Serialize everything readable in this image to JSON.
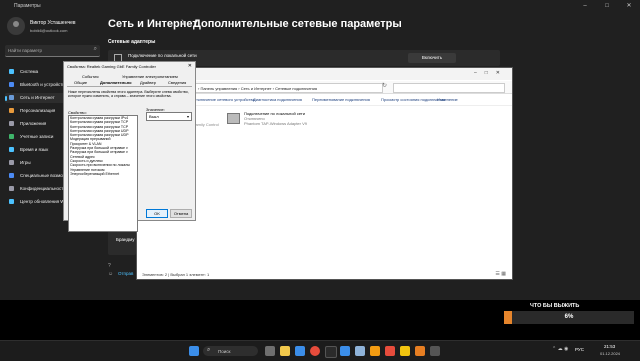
{
  "settings": {
    "title": "Параметры",
    "user": {
      "name": "Виктор Усташенчев",
      "email": "bobik6@outlook.com"
    },
    "search_placeholder": "Найти параметр",
    "nav": [
      {
        "label": "Система",
        "color": "#4cc2ff"
      },
      {
        "label": "Bluetooth и устройства",
        "color": "#4c8bf5"
      },
      {
        "label": "Сеть и Интернет",
        "color": "#6a9bd8"
      },
      {
        "label": "Персонализация",
        "color": "#e89a3c"
      },
      {
        "label": "Приложения",
        "color": "#9a9aa8"
      },
      {
        "label": "Учетные записи",
        "color": "#3fb56b"
      },
      {
        "label": "Время и язык",
        "color": "#4cc2ff"
      },
      {
        "label": "Игры",
        "color": "#9a9aa8"
      },
      {
        "label": "Специальные возможности",
        "color": "#4c8bf5"
      },
      {
        "label": "Конфиденциальность и защита",
        "color": "#9a9aa8"
      },
      {
        "label": "Центр обновления Windows",
        "color": "#4cc2ff"
      }
    ],
    "heading_part1": "Сеть и Интернет",
    "heading_sep": "›",
    "heading_part2": "Дополнительные сетевые параметры",
    "section_label": "Сетевые адаптеры",
    "adapter_card_title": "Подключение по локальной сети",
    "enable_button": "Включить",
    "partial_text": "Брандму",
    "partial_link": "Отправ"
  },
  "network_window": {
    "breadcrumb": "› Панель управления  ›  Сеть и Интернет  ›  Сетевые подключения",
    "toolbar": [
      "Упорядочить ▾",
      "Отключение сетевого устройства",
      "Диагностика подключения",
      "Переименование подключения",
      "Просмотр состояния подключения",
      "Изменение"
    ],
    "adapter": {
      "name": "Подключение по локальной сети",
      "status": "Отключено",
      "device": "Phantom TAP-Windows Adapter V9"
    },
    "hidden_item": "Family Control",
    "status_bar": "Элементов: 2  |  Выбран 1 элемент: 1"
  },
  "dialog": {
    "title": "Свойства: Realtek Gaming GbE Family Controller",
    "tabs_row1": [
      "События",
      "Управление электропитанием"
    ],
    "tabs_row2": [
      "Общие",
      "Дополнительно",
      "Драйвер",
      "Сведения"
    ],
    "description": "Ниже перечислены свойства этого адаптера. Выберите слева свойство, которое нужно изменить, а справа – значение этого свойства.",
    "property_label": "Свойство:",
    "value_label": "Значение:",
    "properties": [
      "Контрольная сумма разгрузки IPv4",
      "Контрольная сумма разгрузки TCP",
      "Контрольная сумма разгрузки TCP",
      "Контрольная сумма разгрузки UDP",
      "Контрольная сумма разгрузки UDP",
      "Модерация прерываний",
      "Приоритет & VLAN",
      "Разгрузка при большой отправке v",
      "Разгрузка при большой отправке v",
      "Сетевой адрес",
      "Скорость и дуплекс",
      "Скорость при включении по локалы",
      "Управление потоком",
      "Энергосберегающий Ethernet"
    ],
    "value": "Выкл",
    "ok": "OK",
    "cancel": "Отмена"
  },
  "overlay": {
    "title": "ЧТО БЫ ВЫЖИТЬ",
    "progress_text": "6%",
    "progress_value": 0.06
  },
  "taskbar": {
    "search_placeholder": "Поиск",
    "lang": "РУС",
    "time": "21:53",
    "date": "01.12.2024"
  }
}
